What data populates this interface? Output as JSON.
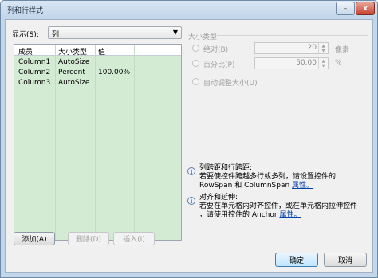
{
  "window": {
    "title": "列和行样式",
    "min_label": "–",
    "close_label": "x"
  },
  "show": {
    "label": "显示(S):",
    "value": "列",
    "arrow": "▼"
  },
  "grid": {
    "columns": [
      "成员",
      "大小类型",
      "值"
    ],
    "rows": [
      {
        "member": "Column1",
        "size_type": "AutoSize",
        "value": ""
      },
      {
        "member": "Column2",
        "size_type": "Percent",
        "value": "100.00%"
      },
      {
        "member": "Column3",
        "size_type": "AutoSize",
        "value": ""
      }
    ]
  },
  "buttons": {
    "add": "添加(A)",
    "delete": "删除(D)",
    "insert": "插入(I)",
    "ok": "确定",
    "cancel": "取消"
  },
  "size_type": {
    "group_title": "大小类型",
    "absolute_label": "绝对(B)",
    "absolute_value": "20",
    "absolute_unit": "像素",
    "percent_label": "百分比(P)",
    "percent_value": "50.00",
    "percent_unit": "%",
    "autosize_label": "自动调整大小(U)"
  },
  "info": {
    "span_title": "列跨距和行跨距:",
    "span_line1": "若要使控件跨越多行或多列，请设置控件的",
    "span_line2": "RowSpan 和 ColumnSpan",
    "span_link": "属性。",
    "align_title": "对齐和延伸:",
    "align_line1": "若要在单元格内对齐控件，或在单元格内拉伸控件",
    "align_line2": "，请使用控件的 Anchor",
    "align_link": "属性。"
  }
}
